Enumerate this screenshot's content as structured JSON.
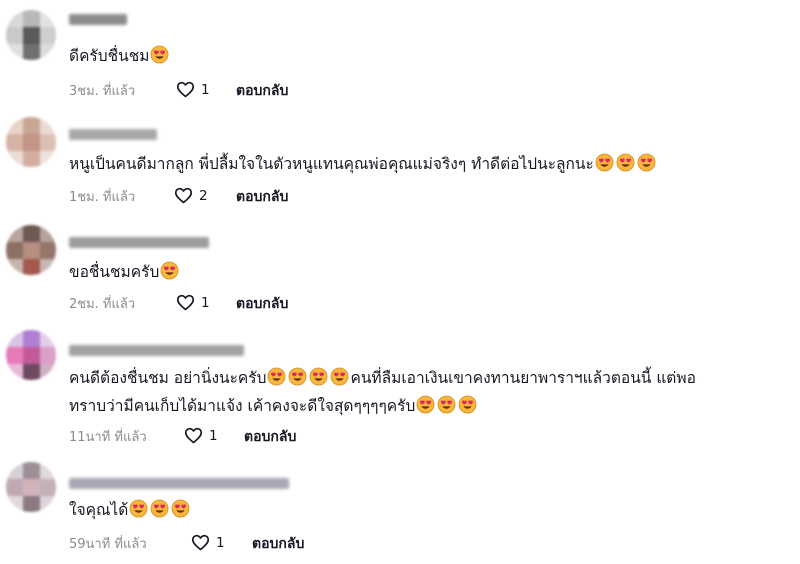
{
  "colors": {
    "time": "#8a8b91",
    "text": "#161823",
    "emoji_face": "#f6b73c",
    "emoji_heart": "#e0245e"
  },
  "icons": {
    "like": "heart-outline-icon",
    "emoji": "smiling-face-with-heart-eyes-icon"
  },
  "comments": [
    {
      "text_parts": [
        "ดีครับชื่นชม"
      ],
      "emoji_after": [
        1
      ],
      "time": "3ชม. ที่แล้ว",
      "likes": "1",
      "reply": "ตอบกลับ"
    },
    {
      "text_parts": [
        "หนูเป็นคนดีมากลูก พี่ปลื้มใจในตัวหนูแทนคุณพ่อคุณแม่จริงๆ ทำดีต่อไปนะลูกนะ"
      ],
      "emoji_after": [
        3
      ],
      "time": "1ชม. ที่แล้ว",
      "likes": "2",
      "reply": "ตอบกลับ"
    },
    {
      "text_parts": [
        "ขอชื่นชมครับ"
      ],
      "emoji_after": [
        1
      ],
      "time": "2ชม. ที่แล้ว",
      "likes": "1",
      "reply": "ตอบกลับ"
    },
    {
      "text_parts": [
        "คนดีต้องชื่นชม อย่านิ่งนะครับ",
        "คนที่ลืมเอาเงินเขาคงทานยาพาราฯแล้วตอนนี้ แต่พอ",
        "ทราบว่ามีคนเก็บได้มาแจ้ง เค้าคงจะดีใจสุดๆๆๆๆครับ"
      ],
      "emoji_after": [
        4,
        0,
        3
      ],
      "time": "11นาที ที่แล้ว",
      "likes": "1",
      "reply": "ตอบกลับ"
    },
    {
      "text_parts": [
        "ใจคุณได้"
      ],
      "emoji_after": [
        3
      ],
      "time": "59นาที ที่แล้ว",
      "likes": "1",
      "reply": "ตอบกลับ"
    }
  ]
}
